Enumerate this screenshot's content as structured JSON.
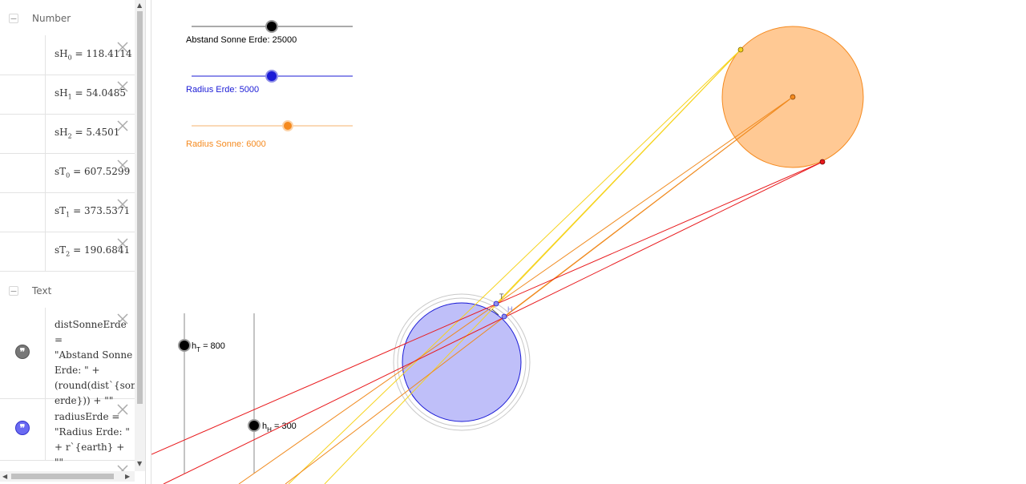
{
  "algebra": {
    "groups": {
      "number": "Number",
      "text": "Text"
    },
    "collapse_symbol": "−",
    "numbers": [
      {
        "name": "sH",
        "sub": "0",
        "value": "118.4114"
      },
      {
        "name": "sH",
        "sub": "1",
        "value": "54.0485"
      },
      {
        "name": "sH",
        "sub": "2",
        "value": "5.4501"
      },
      {
        "name": "sT",
        "sub": "0",
        "value": "607.5299"
      },
      {
        "name": "sT",
        "sub": "1",
        "value": "373.5371"
      },
      {
        "name": "sT",
        "sub": "2",
        "value": "190.6841"
      }
    ],
    "texts": [
      {
        "line1": "distSonneErde =",
        "line2": "\"Abstand Sonne",
        "line3": "Erde: \" +",
        "line4": "(round(dist`{sonn",
        "line5": "erde})) + \"\""
      },
      {
        "line1": "radiusErde =",
        "line2": "\"Radius Erde: \"",
        "line3": "+ r`{earth} + \"\""
      }
    ]
  },
  "sliders": {
    "distance_label": "Abstand Sonne Erde: 25000",
    "earth_label": "Radius Erde: 5000",
    "sun_label": "Radius Sonne: 6000",
    "hT_name": "h",
    "hT_sub": "T",
    "hT_value": "= 800",
    "hH_name": "h",
    "hH_sub": "H",
    "hH_value": "= 300"
  },
  "points": {
    "T": "T",
    "H": "H"
  },
  "colors": {
    "earth_fill": "#bfbff9",
    "earth_stroke": "#1b1bd6",
    "sun_fill": "#ffc994",
    "sun_stroke": "#f58a1f",
    "ray_red": "#e8191c",
    "ray_orange": "#f08a1e",
    "ray_yellow": "#f6d31c"
  },
  "icons": {
    "delete": "close-icon",
    "text": "quote-icon"
  }
}
